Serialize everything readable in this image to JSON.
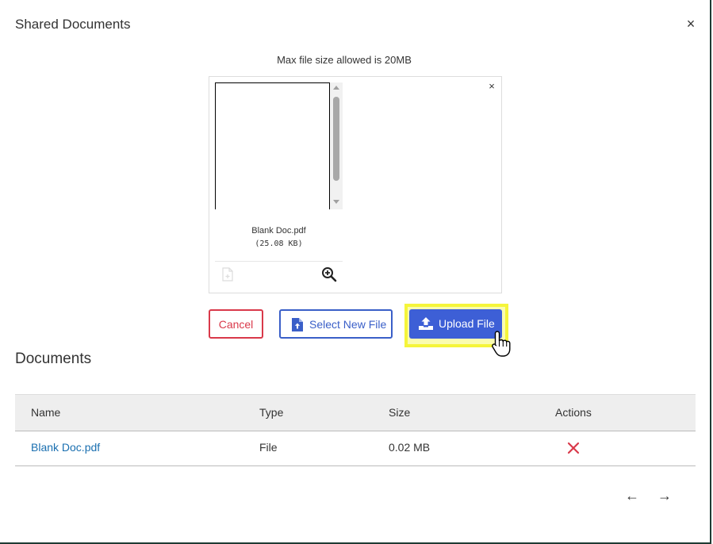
{
  "modal": {
    "title": "Shared Documents",
    "close_label": "×"
  },
  "upload": {
    "max_size_text": "Max file size allowed is 20MB",
    "remove_label": "×",
    "file": {
      "name": "Blank Doc.pdf",
      "size": "(25.08 KB)"
    }
  },
  "buttons": {
    "cancel": "Cancel",
    "select_new": "Select New File",
    "upload": "Upload File"
  },
  "documents": {
    "title": "Documents",
    "columns": [
      "Name",
      "Type",
      "Size",
      "Actions"
    ],
    "rows": [
      {
        "name": "Blank Doc.pdf",
        "type": "File",
        "size": "0.02 MB"
      }
    ]
  },
  "pagination": {
    "prev": "←",
    "next": "→"
  },
  "colors": {
    "primary": "#3d5fd6",
    "danger": "#d9394a",
    "link": "#1a6fb0",
    "highlight": "#f5f53a"
  },
  "icons": {
    "select_file": "file-upload-icon",
    "upload": "upload-tray-icon",
    "zoom": "zoom-in-icon",
    "delete": "delete-x-icon",
    "doc": "document-icon"
  }
}
